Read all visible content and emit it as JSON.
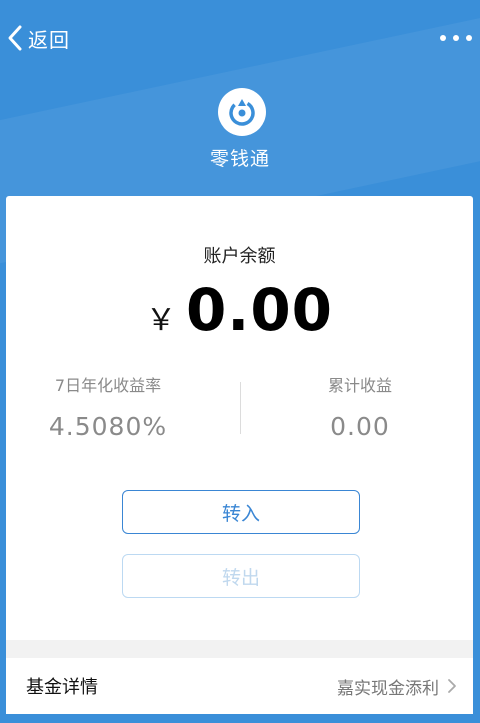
{
  "header": {
    "back_label": "返回"
  },
  "app": {
    "name": "零钱通"
  },
  "account": {
    "balance_label": "账户余额",
    "currency_symbol": "￥",
    "balance": "0.00"
  },
  "stats": {
    "rate_label": "7日年化收益率",
    "rate_value": "4.5080%",
    "income_label": "累计收益",
    "income_value": "0.00"
  },
  "actions": {
    "transfer_in": "转入",
    "transfer_out": "转出"
  },
  "fund": {
    "label": "基金详情",
    "value": "嘉实现金添利"
  },
  "colors": {
    "brand_blue": "#3a8fd9",
    "accent": "#3a86d4",
    "disabled": "#bcd9f2"
  }
}
